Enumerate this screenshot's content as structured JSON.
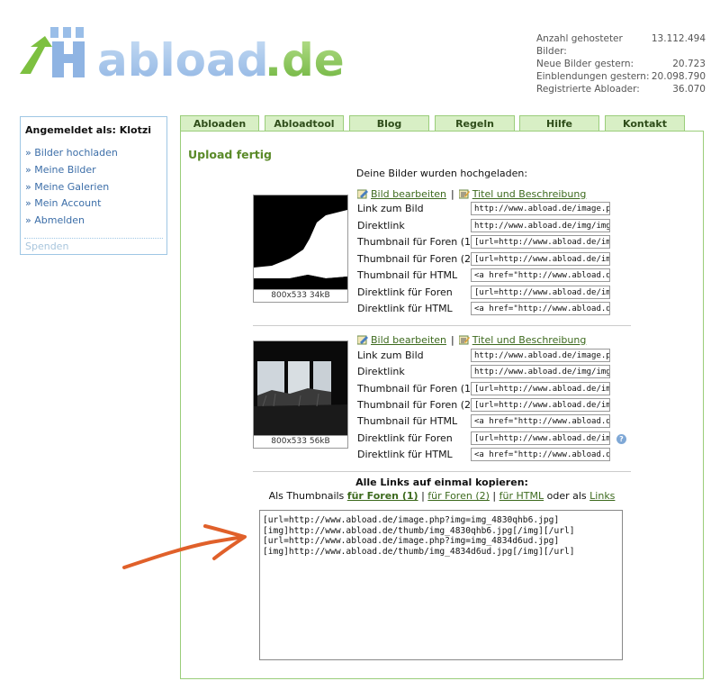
{
  "logo": {
    "text": "abload.de"
  },
  "stats": [
    {
      "label": "Anzahl gehosteter Bilder:",
      "value": "13.112.494"
    },
    {
      "label": "Neue Bilder gestern:",
      "value": "20.723"
    },
    {
      "label": "Einblendungen gestern:",
      "value": "20.098.790"
    },
    {
      "label": "Registrierte Abloader:",
      "value": "36.070"
    }
  ],
  "sidebar": {
    "logged_in": "Angemeldet als: Klotzi",
    "items": [
      "» Bilder hochladen",
      "» Meine Bilder",
      "» Meine Galerien",
      "» Mein Account",
      "» Abmelden"
    ],
    "donate": "Spenden"
  },
  "tabs": [
    "Abloaden",
    "Abloadtool",
    "Blog",
    "Regeln",
    "Hilfe",
    "Kontakt"
  ],
  "main": {
    "title": "Upload fertig",
    "subtitle": "Deine Bilder wurden hochgeladen:",
    "edit_label": "Bild bearbeiten",
    "separator": "|",
    "title_desc_label": "Titel und Beschreibung",
    "link_labels": [
      "Link zum Bild",
      "Direktlink",
      "Thumbnail für Foren (1)",
      "Thumbnail für Foren (2)",
      "Thumbnail für HTML",
      "Direktlink für Foren",
      "Direktlink für HTML"
    ],
    "images": [
      {
        "caption": "800x533 34kB",
        "fields": [
          "http://www.abload.de/image.php?i",
          "http://www.abload.de/img/img_48",
          "[url=http://www.abload.de/image.",
          "[url=http://www.abload.de/image.",
          "<a href=\"http://www.abload.de/im",
          "[url=http://www.abload.de/image.",
          "<a href=\"http://www.abload.de/im"
        ]
      },
      {
        "caption": "800x533 56kB",
        "fields": [
          "http://www.abload.de/image.php?i",
          "http://www.abload.de/img/img_48",
          "[url=http://www.abload.de/image.",
          "[url=http://www.abload.de/image.",
          "<a href=\"http://www.abload.de/im",
          "[url=http://www.abload.de/image.",
          "<a href=\"http://www.abload.de/im"
        ]
      }
    ],
    "all_links_title": "Alle Links auf einmal kopieren:",
    "all_links": {
      "prefix": "Als Thumbnails",
      "opt1": "für Foren (1)",
      "opt2": "für Foren (2)",
      "opt3": "für HTML",
      "or_as": "oder als",
      "opt4": "Links"
    },
    "textarea_lines": [
      "[url=http://www.abload.de/image.php?img=img_4830qhb6.jpg]",
      "[img]http://www.abload.de/thumb/img_4830qhb6.jpg[/img][/url]",
      "[url=http://www.abload.de/image.php?img=img_4834d6ud.jpg]",
      "[img]http://www.abload.de/thumb/img_4834d6ud.jpg[/img][/url]"
    ],
    "help_icon": "?"
  },
  "colors": {
    "accent_green": "#5a8a28",
    "tab_bg": "#d8efc5",
    "link_blue": "#3c6ea8",
    "arrow": "#e0602a"
  }
}
